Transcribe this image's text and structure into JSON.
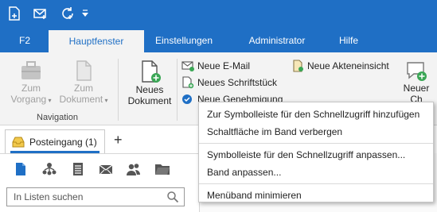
{
  "qat": {
    "icons": [
      "new-document-icon",
      "mail-icon",
      "refresh-icon",
      "qat-dropdown-icon"
    ]
  },
  "tabs": [
    {
      "label": "F2"
    },
    {
      "label": "Hauptfenster"
    },
    {
      "label": "Einstellungen"
    },
    {
      "label": "Administrator"
    },
    {
      "label": "Hilfe"
    }
  ],
  "ribbon": {
    "zum_vorgang": {
      "line1": "Zum",
      "line2": "Vorgang"
    },
    "zum_dokument": {
      "line1": "Zum",
      "line2": "Dokument"
    },
    "navigation_group": "Navigation",
    "neues_dokument": {
      "line1": "Neues",
      "line2": "Dokument"
    },
    "neue_email": "Neue E-Mail",
    "neues_schriftstueck": "Neues Schriftstück",
    "neue_genehmigung": "Neue Genehmigung",
    "neue_akteneinsicht": "Neue Akteneinsicht",
    "neuer_partial": {
      "line1": "Neuer",
      "line2": "Ch"
    }
  },
  "doctab": {
    "label": "Posteingang (1)"
  },
  "search": {
    "placeholder": "In Listen suchen"
  },
  "context_menu": {
    "items": [
      "Zur Symbolleiste für den Schnellzugriff hinzufügen",
      "Schaltfläche im Band verbergen",
      "Symbolleiste für den Schnellzugriff anpassen...",
      "Band anpassen...",
      "Menüband minimieren"
    ]
  },
  "colors": {
    "brand": "#1f6fc5",
    "ribbon_bg": "#f3f3f3",
    "accent_green": "#3aa655"
  }
}
